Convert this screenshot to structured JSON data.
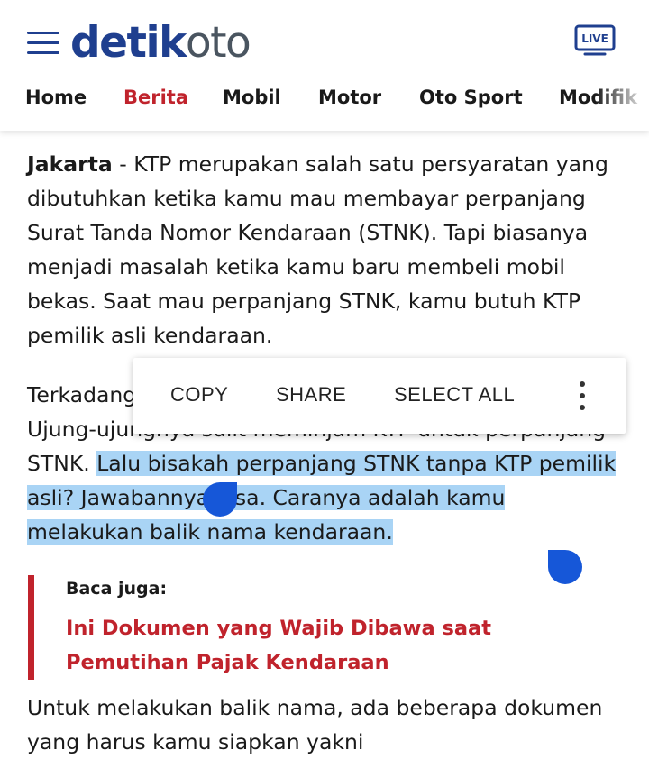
{
  "header": {
    "logo_part1": "detik",
    "logo_part2": "oto",
    "live_label": "LIVE"
  },
  "nav": {
    "items": [
      {
        "label": "Home"
      },
      {
        "label": "Berita"
      },
      {
        "label": "Mobil"
      },
      {
        "label": "Motor"
      },
      {
        "label": "Oto Sport"
      },
      {
        "label": "Modifik"
      }
    ]
  },
  "article": {
    "p1_lead": "Jakarta",
    "p1_text": " - KTP merupakan salah satu persyaratan yang dibutuhkan ketika kamu mau membayar perpanjang Surat Tanda Nomor Kendaraan (STNK). Tapi biasanya menjadi masalah ketika kamu baru membeli mobil bekas. Saat mau perpanjang STNK, kamu butuh KTP pemilik asli kendaraan.",
    "p2_text": "Terkadang pemilik aslinya sudah sulit untuk dihubungi. Ujung-ujungnya sulit meminjam KTP untuk perpanjang STNK. ",
    "p2_selected": "Lalu bisakah perpanjang STNK tanpa KTP pemilik asli? Jawabannya bisa. Caranya adalah kamu melakukan balik nama kendaraan.",
    "p3_text": "Untuk melakukan balik nama, ada beberapa dokumen yang harus kamu siapkan yakni"
  },
  "related": {
    "label": "Baca juga:",
    "link": "Ini Dokumen yang Wajib Dibawa saat Pemutihan Pajak Kendaraan"
  },
  "context_menu": {
    "copy": "COPY",
    "share": "SHARE",
    "select_all": "SELECT ALL"
  },
  "colors": {
    "brand_blue": "#1f3f8f",
    "accent_red": "#c0232c",
    "selection": "#a9d4f5",
    "handle": "#1657d8"
  }
}
